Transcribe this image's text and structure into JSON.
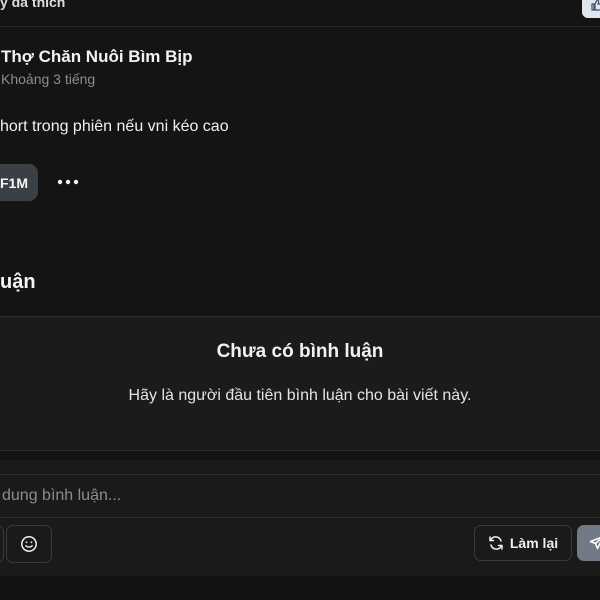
{
  "header": {
    "liked_text": "y đã thích",
    "liked_icon": "thumb-icon"
  },
  "post": {
    "author_name": "Thợ Chăn Nuôi Bìm Bịp",
    "time": "Khoảng 3 tiếng",
    "body": "hort trong phiên nếu vni kéo cao",
    "tag": "F1M",
    "more_icon": "more-horizontal-icon"
  },
  "comments": {
    "section_title": "uận",
    "empty_title": "Chưa có bình luận",
    "empty_subtitle": "Hãy là người đầu tiên bình luận cho bài viết này."
  },
  "composer": {
    "placeholder": "dung bình luận...",
    "value": "",
    "emoji_icon": "smile-icon",
    "reset_icon": "refresh-icon",
    "reset_label": "Làm lại",
    "send_icon": "send-icon"
  },
  "colors": {
    "background": "#141414",
    "panel": "#1b1b1b",
    "chip": "#3b3f46",
    "send_button": "#707b86",
    "top_action": "#dfe6ee"
  }
}
